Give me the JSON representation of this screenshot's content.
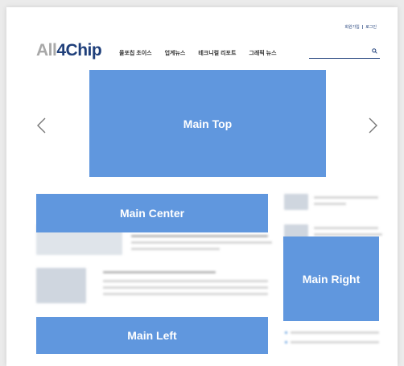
{
  "header": {
    "top_links": [
      "회원가입",
      "로그인"
    ],
    "logo": {
      "part_a": "All",
      "part_b": "4Chip"
    },
    "nav": [
      "올포칩 초이스",
      "업계뉴스",
      "테크니컬 리포트",
      "그래픽 뉴스"
    ],
    "search_icon": "search-icon"
  },
  "slider": {
    "prev_icon": "chevron-left-icon",
    "next_icon": "chevron-right-icon"
  },
  "regions": {
    "main_top": "Main Top",
    "main_center": "Main Center",
    "main_right": "Main Right",
    "main_left": "Main Left"
  },
  "colors": {
    "accent": "#6097de",
    "brand": "#1f3f7a",
    "logo_gray": "#a8a8a8"
  }
}
